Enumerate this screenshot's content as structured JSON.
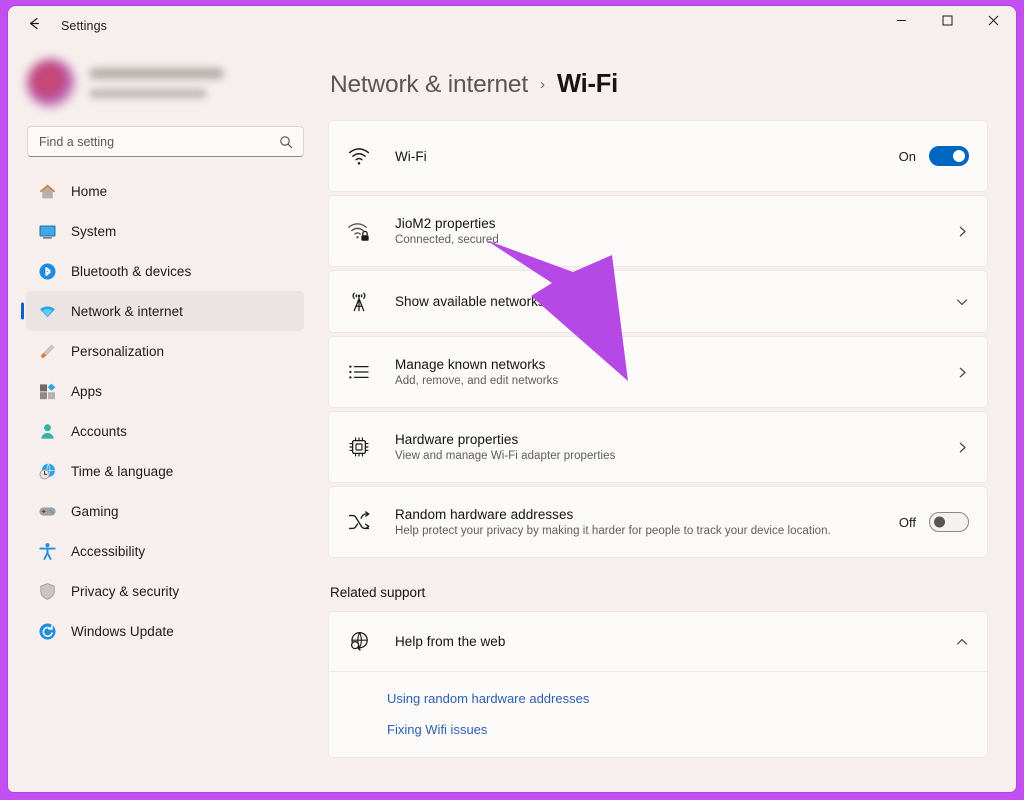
{
  "window": {
    "app_title": "Settings",
    "back_icon": "back-arrow-icon",
    "controls": {
      "minimize": "minimize-icon",
      "maximize": "maximize-icon",
      "close": "close-icon"
    },
    "frame_color": "#c44ff0"
  },
  "sidebar": {
    "profile": {
      "avatar": "user-avatar",
      "name_redacted": true
    },
    "search": {
      "placeholder": "Find a setting",
      "value": "",
      "icon": "search-icon"
    },
    "items": [
      {
        "label": "Home",
        "icon": "home-icon",
        "selected": false
      },
      {
        "label": "System",
        "icon": "system-icon",
        "selected": false
      },
      {
        "label": "Bluetooth & devices",
        "icon": "bluetooth-icon",
        "selected": false
      },
      {
        "label": "Network & internet",
        "icon": "network-wifi-icon",
        "selected": true
      },
      {
        "label": "Personalization",
        "icon": "paintbrush-icon",
        "selected": false
      },
      {
        "label": "Apps",
        "icon": "apps-icon",
        "selected": false
      },
      {
        "label": "Accounts",
        "icon": "person-icon",
        "selected": false
      },
      {
        "label": "Time & language",
        "icon": "clock-globe-icon",
        "selected": false
      },
      {
        "label": "Gaming",
        "icon": "gamepad-icon",
        "selected": false
      },
      {
        "label": "Accessibility",
        "icon": "accessibility-icon",
        "selected": false
      },
      {
        "label": "Privacy & security",
        "icon": "shield-icon",
        "selected": false
      },
      {
        "label": "Windows Update",
        "icon": "update-icon",
        "selected": false
      }
    ]
  },
  "main": {
    "breadcrumb_parent": "Network & internet",
    "breadcrumb_separator": "›",
    "page_title": "Wi-Fi",
    "cards": [
      {
        "title": "Wi-Fi",
        "subtitle": "",
        "icon": "wifi-icon",
        "control": "toggle",
        "toggle_state_label": "On",
        "toggle_on": true
      },
      {
        "title": "JioM2 properties",
        "subtitle": "Connected, secured",
        "icon": "wifi-lock-icon",
        "control": "chevron-right",
        "toggle_state_label": "",
        "toggle_on": false
      },
      {
        "title": "Show available networks",
        "subtitle": "",
        "icon": "broadcast-tower-icon",
        "control": "chevron-down",
        "toggle_state_label": "",
        "toggle_on": false
      },
      {
        "title": "Manage known networks",
        "subtitle": "Add, remove, and edit networks",
        "icon": "list-icon",
        "control": "chevron-right",
        "toggle_state_label": "",
        "toggle_on": false
      },
      {
        "title": "Hardware properties",
        "subtitle": "View and manage Wi-Fi adapter properties",
        "icon": "chip-icon",
        "control": "chevron-right",
        "toggle_state_label": "",
        "toggle_on": false
      },
      {
        "title": "Random hardware addresses",
        "subtitle": "Help protect your privacy by making it harder for people to track your device location.",
        "icon": "shuffle-icon",
        "control": "toggle",
        "toggle_state_label": "Off",
        "toggle_on": false
      }
    ],
    "related_support": {
      "heading": "Related support",
      "help_card": {
        "title": "Help from the web",
        "icon": "globe-search-icon",
        "expand_icon": "chevron-up-icon",
        "expanded": true,
        "links": [
          "Using random hardware addresses",
          "Fixing Wifi issues"
        ]
      }
    }
  },
  "annotation": {
    "arrow_color": "#b648e6",
    "points_to": "JioM2 properties"
  }
}
